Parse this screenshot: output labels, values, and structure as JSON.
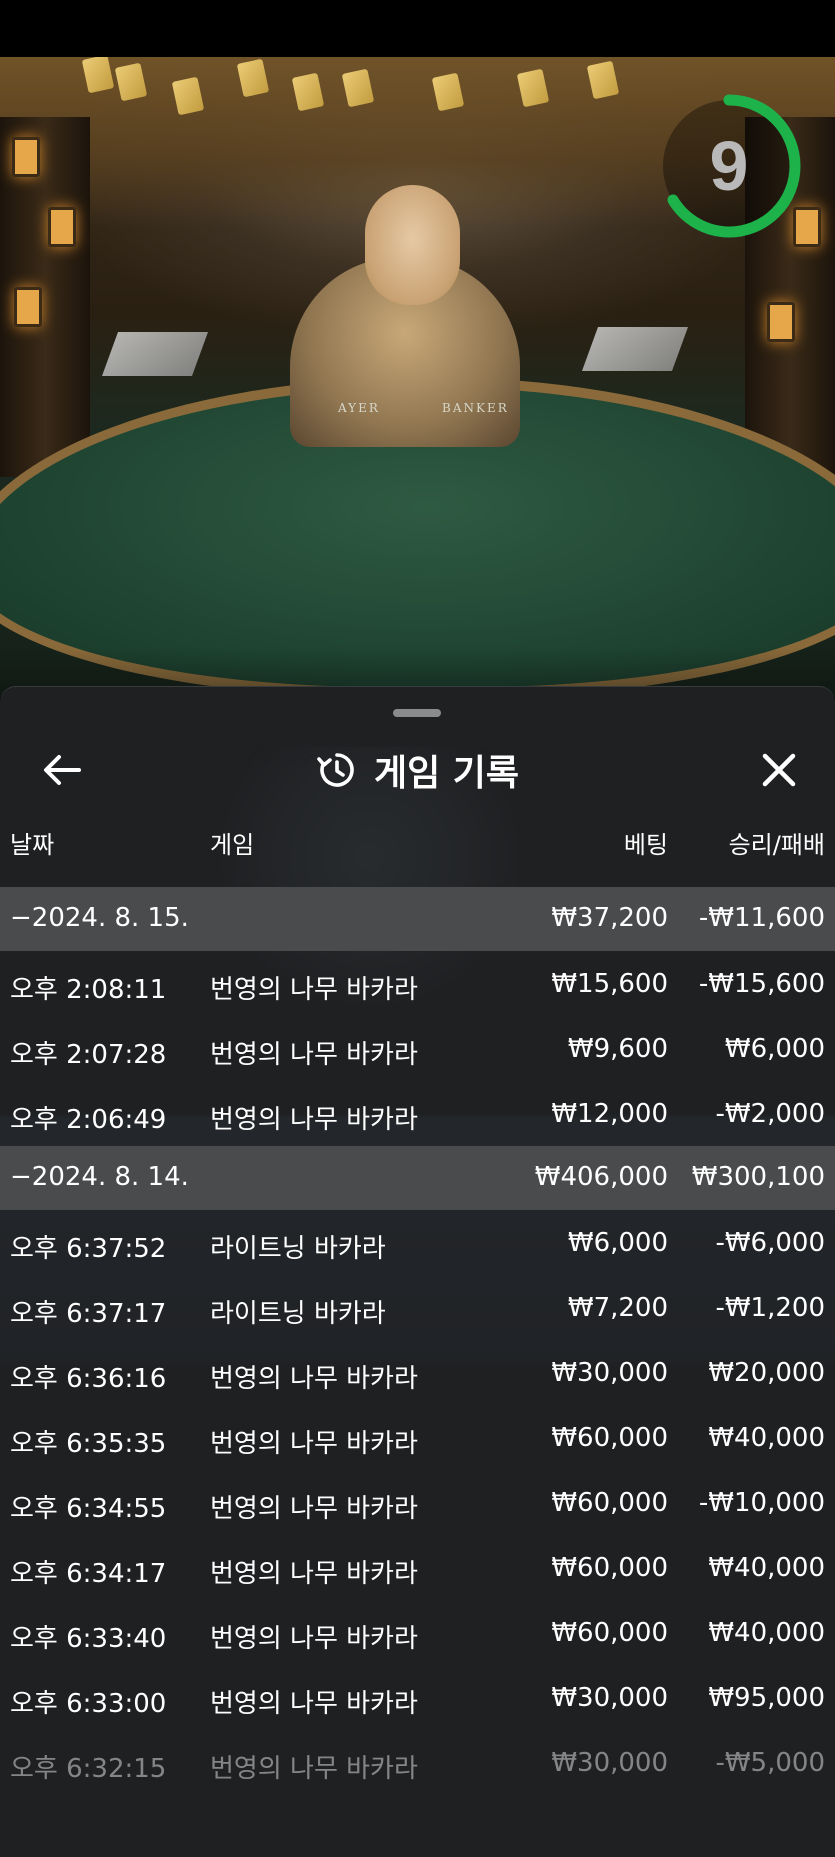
{
  "video": {
    "timer": "9",
    "table_labels": {
      "player": "AYER",
      "banker": "BANKER"
    }
  },
  "history": {
    "title": "게임 기록",
    "columns": {
      "date": "날짜",
      "game": "게임",
      "bet": "베팅",
      "win_loss": "승리/패배"
    },
    "groups": [
      {
        "date": "−2024. 8. 15.",
        "bet": "₩37,200",
        "win_loss": "-₩11,600",
        "rows": [
          {
            "time": "오후 2:08:11",
            "game": "번영의 나무 바카라",
            "bet": "₩15,600",
            "win_loss": "-₩15,600"
          },
          {
            "time": "오후 2:07:28",
            "game": "번영의 나무 바카라",
            "bet": "₩9,600",
            "win_loss": "₩6,000"
          },
          {
            "time": "오후 2:06:49",
            "game": "번영의 나무 바카라",
            "bet": "₩12,000",
            "win_loss": "-₩2,000"
          }
        ]
      },
      {
        "date": "−2024. 8. 14.",
        "bet": "₩406,000",
        "win_loss": "₩300,100",
        "rows": [
          {
            "time": "오후 6:37:52",
            "game": "라이트닝 바카라",
            "bet": "₩6,000",
            "win_loss": "-₩6,000"
          },
          {
            "time": "오후 6:37:17",
            "game": "라이트닝 바카라",
            "bet": "₩7,200",
            "win_loss": "-₩1,200"
          },
          {
            "time": "오후 6:36:16",
            "game": "번영의 나무 바카라",
            "bet": "₩30,000",
            "win_loss": "₩20,000"
          },
          {
            "time": "오후 6:35:35",
            "game": "번영의 나무 바카라",
            "bet": "₩60,000",
            "win_loss": "₩40,000"
          },
          {
            "time": "오후 6:34:55",
            "game": "번영의 나무 바카라",
            "bet": "₩60,000",
            "win_loss": "-₩10,000"
          },
          {
            "time": "오후 6:34:17",
            "game": "번영의 나무 바카라",
            "bet": "₩60,000",
            "win_loss": "₩40,000"
          },
          {
            "time": "오후 6:33:40",
            "game": "번영의 나무 바카라",
            "bet": "₩60,000",
            "win_loss": "₩40,000"
          },
          {
            "time": "오후 6:33:00",
            "game": "번영의 나무 바카라",
            "bet": "₩30,000",
            "win_loss": "₩95,000"
          },
          {
            "time": "오후 6:32:15",
            "game": "번영의 나무 바카라",
            "bet": "₩30,000",
            "win_loss": "-₩5,000"
          }
        ]
      }
    ]
  },
  "icons": {
    "back": "arrow-left-icon",
    "history": "history-clock-icon",
    "close": "close-icon"
  },
  "colors": {
    "sheet_bg": "#1f2022",
    "date_row_bg": "#4a4b4d",
    "timer_ring": "#1db34a",
    "text": "#ffffff"
  }
}
